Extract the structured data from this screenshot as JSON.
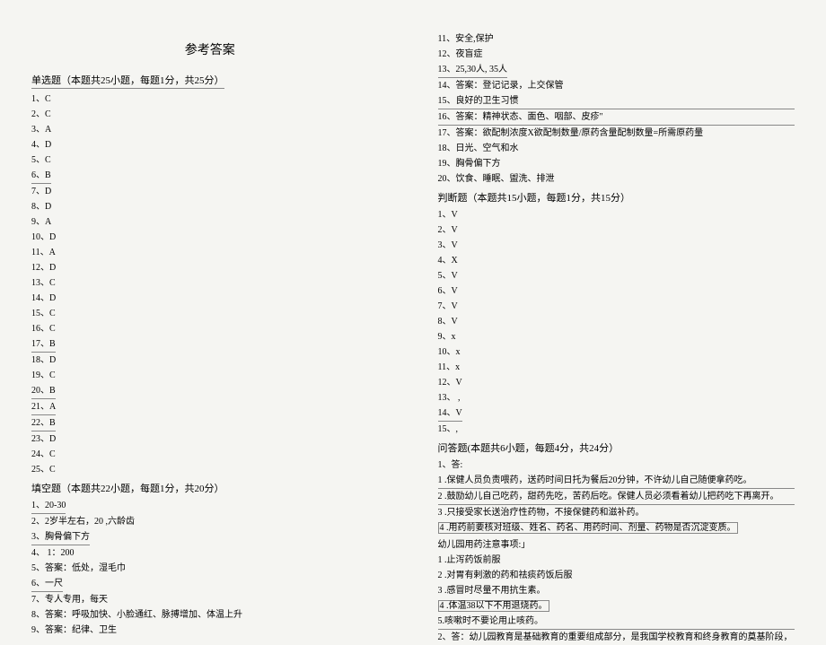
{
  "title": "参考答案",
  "mc": {
    "header": "单选题（本题共25小题，每题1分，共25分）",
    "items": [
      {
        "n": "1、",
        "v": "C",
        "u": false
      },
      {
        "n": "2、",
        "v": "C",
        "u": false
      },
      {
        "n": "3、",
        "v": "A",
        "u": false
      },
      {
        "n": "4、",
        "v": "D",
        "u": false
      },
      {
        "n": "5、",
        "v": "C",
        "u": false
      },
      {
        "n": "6、",
        "v": "B",
        "u": true
      },
      {
        "n": "7、",
        "v": "D",
        "u": false
      },
      {
        "n": "8、",
        "v": "D",
        "u": false
      },
      {
        "n": "9、",
        "v": "A",
        "u": false
      },
      {
        "n": "10、",
        "v": "D",
        "u": false
      },
      {
        "n": "11、",
        "v": "A",
        "u": false
      },
      {
        "n": "12、",
        "v": "D",
        "u": false
      },
      {
        "n": "13、",
        "v": "C",
        "u": false
      },
      {
        "n": "14、",
        "v": "D",
        "u": false
      },
      {
        "n": "15、",
        "v": "C",
        "u": false
      },
      {
        "n": "16、",
        "v": "C",
        "u": false
      },
      {
        "n": "17、",
        "v": "B",
        "u": true
      },
      {
        "n": "18、",
        "v": "D",
        "u": false
      },
      {
        "n": "19、",
        "v": "C",
        "u": false
      },
      {
        "n": "20、",
        "v": "B",
        "u": true
      },
      {
        "n": "21、",
        "v": "A",
        "u": true
      },
      {
        "n": "22、",
        "v": "B",
        "u": true
      },
      {
        "n": "23、",
        "v": "D",
        "u": false
      },
      {
        "n": "24、",
        "v": "C",
        "u": false
      },
      {
        "n": "25、",
        "v": "C",
        "u": false
      }
    ]
  },
  "fill": {
    "header": "填空题（本题共22小题，每题1分，共20分）",
    "left": [
      {
        "t": "1、20-30",
        "u": true
      },
      {
        "t": "2、2岁半左右，20 ,六龄齿",
        "u": false
      },
      {
        "t": "3、胸骨偏下方",
        "u": true
      },
      {
        "t": "4、 1：200",
        "u": false
      },
      {
        "t": "5、答案：低处，湿毛巾",
        "u": false
      },
      {
        "t": "6、一尺",
        "u": true
      },
      {
        "t": "7、专人专用，每天",
        "u": false
      },
      {
        "t": "8、答案：呼吸加快、小脸通红、脉搏增加、体温上升",
        "u": false
      },
      {
        "t": "9、答案：纪律、卫生",
        "u": false
      }
    ],
    "right": [
      {
        "t": "11、安全,保护",
        "u": false
      },
      {
        "t": "12、夜盲症",
        "u": false
      },
      {
        "t": "13、25,30人,  35人",
        "u": true
      },
      {
        "t": "14、答案：登记记录，上交保管",
        "u": false
      },
      {
        "t": "15、良好的卫生习惯",
        "u": true,
        "full": true
      },
      {
        "t": "16、答案：精神状态、面色、咽部、皮疹\"",
        "u": true,
        "full": true
      },
      {
        "t": "17、答案：欲配制浓度X欲配制数量/原药含量配制数量=所需原药量",
        "u": false
      },
      {
        "t": "18、日光、空气和水",
        "u": false
      },
      {
        "t": "19、胸骨偏下方",
        "u": false
      },
      {
        "t": "20、饮食、睡眠、盥洗、排泄",
        "u": false
      }
    ]
  },
  "tf": {
    "header": "判断题（本题共15小题，每题1分，共15分）",
    "items": [
      {
        "t": "1、V",
        "u": false
      },
      {
        "t": "2、V",
        "u": false
      },
      {
        "t": "3、V",
        "u": false
      },
      {
        "t": "4、X",
        "u": false
      },
      {
        "t": "5、V",
        "u": false
      },
      {
        "t": "6、V",
        "u": false
      },
      {
        "t": "7、V",
        "u": false
      },
      {
        "t": "8、V",
        "u": false
      },
      {
        "t": "9、x",
        "u": false
      },
      {
        "t": "10、x",
        "u": false
      },
      {
        "t": "11、x",
        "u": false
      },
      {
        "t": "12、V",
        "u": false
      },
      {
        "t": "13、 ,",
        "u": false
      },
      {
        "t": "14、V",
        "u": true
      },
      {
        "t": "15、,",
        "u": false
      }
    ]
  },
  "qa": {
    "header": "问答题(本题共6小题，每题4分，共24分）",
    "q1_header": "1、答:",
    "q1_lines": [
      {
        "t": "  1 .保健人员负责喂药，送药时间日托为餐后20分钟，不许幼儿自己随便拿药吃。",
        "u": true,
        "full": true
      },
      {
        "t": "  2 .鼓励幼儿自己吃药，甜药先吃，苦药后吃。保健人员必须看着幼儿把药吃下再离开。",
        "u": true,
        "full": true
      },
      {
        "t": "  3 .只接受家长送治疗性药物，不接保健药和滋补药。",
        "u": false
      },
      {
        "t": "4 .用药前要核对班级、姓名、药名、用药时间、剂量、药物是否沉淀变质。",
        "box": true
      }
    ],
    "q2_header": "幼儿园用药注意事项:」",
    "q2_lines": [
      {
        "t": "1 .止泻药饭前服",
        "u": false
      },
      {
        "t": "2 .对胃有剌激的药和祛痰药饭后服",
        "u": false
      },
      {
        "t": "3 .感冒时尽量不用抗生素。",
        "u": false
      },
      {
        "t": "4 .体温38以下不用退烧药。",
        "box": true
      },
      {
        "t": "5.咳嗽时不要论用止咳药。",
        "u": true,
        "full": true
      }
    ],
    "q2_ans": "2、答：幼儿园教育是基础教育的重要组成部分，是我国学校教育和终身教育的奠基阶段，"
  }
}
